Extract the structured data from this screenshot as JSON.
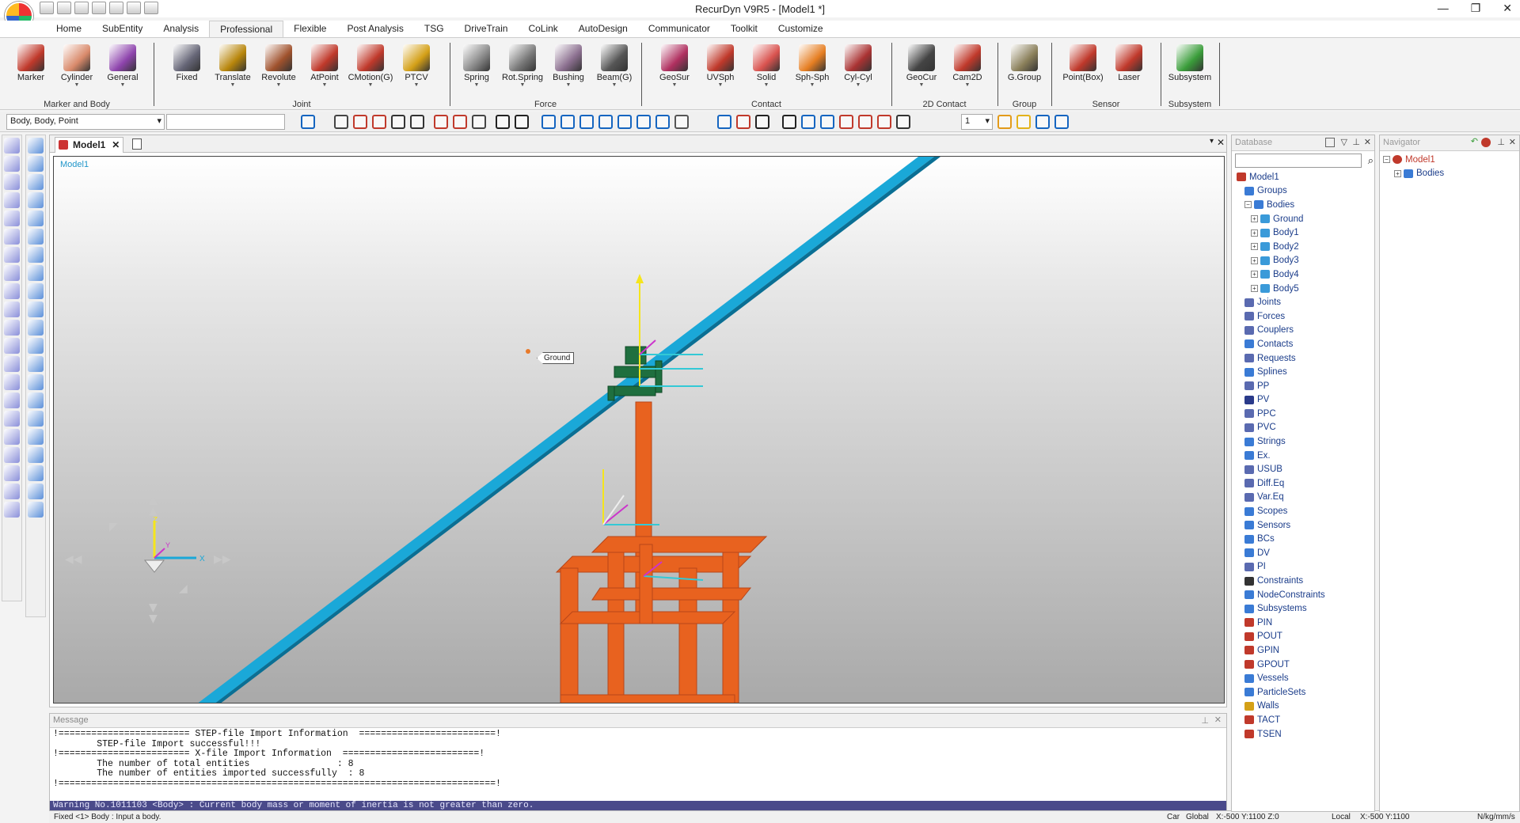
{
  "app": {
    "title": "RecurDyn V9R5  - [Model1 *]",
    "win_min": "—",
    "win_max": "❐",
    "win_close": "✕"
  },
  "ribbon_tabs": [
    "Home",
    "SubEntity",
    "Analysis",
    "Professional",
    "Flexible",
    "Post Analysis",
    "TSG",
    "DriveTrain",
    "CoLink",
    "AutoDesign",
    "Communicator",
    "Toolkit",
    "Customize"
  ],
  "active_tab": "Professional",
  "ribbon_groups": [
    {
      "name": "Marker and Body",
      "items": [
        {
          "label": "Marker",
          "icon": "marker-icon",
          "color": "#c0392b",
          "dd": false
        },
        {
          "label": "Cylinder",
          "icon": "cylinder-icon",
          "color": "#d98a6b",
          "dd": true
        },
        {
          "label": "General",
          "icon": "general-body-icon",
          "color": "#8e44ad",
          "dd": true
        }
      ]
    },
    {
      "name": "Joint",
      "items": [
        {
          "label": "Fixed",
          "icon": "fixed-joint-icon",
          "color": "#667",
          "dd": false
        },
        {
          "label": "Translate",
          "icon": "translate-joint-icon",
          "color": "#b8860b",
          "dd": true
        },
        {
          "label": "Revolute",
          "icon": "revolute-joint-icon",
          "color": "#a0522d",
          "dd": true
        },
        {
          "label": "AtPoint",
          "icon": "atpoint-icon",
          "color": "#c0392b",
          "dd": true
        },
        {
          "label": "CMotion(G)",
          "icon": "cmotion-icon",
          "color": "#c0392b",
          "dd": true
        },
        {
          "label": "PTCV",
          "icon": "ptcv-icon",
          "color": "#d4a017",
          "dd": true
        }
      ]
    },
    {
      "name": "Force",
      "items": [
        {
          "label": "Spring",
          "icon": "spring-icon",
          "color": "#888",
          "dd": true
        },
        {
          "label": "Rot.Spring",
          "icon": "rot-spring-icon",
          "color": "#777",
          "dd": true
        },
        {
          "label": "Bushing",
          "icon": "bushing-icon",
          "color": "#8b6f8f",
          "dd": true
        },
        {
          "label": "Beam(G)",
          "icon": "beam-icon",
          "color": "#555",
          "dd": true
        }
      ]
    },
    {
      "name": "Contact",
      "items": [
        {
          "label": "GeoSur",
          "icon": "geosur-icon",
          "color": "#b03060",
          "dd": true
        },
        {
          "label": "UVSph",
          "icon": "uvsph-icon",
          "color": "#c0392b",
          "dd": true
        },
        {
          "label": "Solid",
          "icon": "solid-contact-icon",
          "color": "#d9534f",
          "dd": true
        },
        {
          "label": "Sph-Sph",
          "icon": "sph-sph-icon",
          "color": "#e67e22",
          "dd": true
        },
        {
          "label": "Cyl-Cyl",
          "icon": "cyl-cyl-icon",
          "color": "#a33",
          "dd": true
        }
      ]
    },
    {
      "name": "2D Contact",
      "items": [
        {
          "label": "GeoCur",
          "icon": "geocur-icon",
          "color": "#444",
          "dd": true
        },
        {
          "label": "Cam2D",
          "icon": "cam2d-icon",
          "color": "#c0392b",
          "dd": true
        }
      ]
    },
    {
      "name": "Group",
      "items": [
        {
          "label": "G.Group",
          "icon": "group-icon",
          "color": "#8a7f5a",
          "dd": false
        }
      ]
    },
    {
      "name": "Sensor",
      "items": [
        {
          "label": "Point(Box)",
          "icon": "point-box-sensor-icon",
          "color": "#c0392b",
          "dd": false
        },
        {
          "label": "Laser",
          "icon": "laser-sensor-icon",
          "color": "#c0392b",
          "dd": false
        }
      ]
    },
    {
      "name": "Subsystem",
      "items": [
        {
          "label": "Subsystem",
          "icon": "subsystem-icon",
          "color": "#3a9d3a",
          "dd": false
        }
      ]
    }
  ],
  "toolbar": {
    "select_value": "Body, Body, Point",
    "layer_value": "1"
  },
  "document": {
    "tab_label": "Model1",
    "viewport_label": "Model1",
    "ground_tag": "Ground",
    "axis_x": "X",
    "axis_y": "Y",
    "axis_z": "Z"
  },
  "message": {
    "title": "Message",
    "lines": [
      "!======================== STEP-file Import Information  =========================!",
      "        STEP-file Import successful!!!",
      "!======================== X-file Import Information  =========================!",
      "        The number of total entities                : 8",
      "        The number of entities imported successfully  : 8",
      "!================================================================================!"
    ],
    "warning": "Warning No.1011103 <Body> : Current body mass or moment of inertia is not greater than zero."
  },
  "status": {
    "left": "Fixed <1> Body : Input a body.",
    "car": "Car",
    "global": "Global",
    "global_coords": "X:-500 Y:1100 Z:0",
    "local": "Local",
    "local_coords": "X:-500 Y:1100",
    "units": "N/kg/mm/s"
  },
  "database": {
    "title": "Database",
    "tree": [
      {
        "label": "Model1",
        "level": 0,
        "pm": "",
        "icon": "model-icon",
        "color": "#c0392b"
      },
      {
        "label": "Groups",
        "level": 1,
        "pm": "",
        "icon": "groups-icon",
        "color": "#3a7bd5"
      },
      {
        "label": "Bodies",
        "level": 1,
        "pm": "−",
        "icon": "bodies-icon",
        "color": "#3a7bd5"
      },
      {
        "label": "Ground",
        "level": 2,
        "pm": "+",
        "icon": "body-icon",
        "color": "#3a9ad9"
      },
      {
        "label": "Body1",
        "level": 2,
        "pm": "+",
        "icon": "body-icon",
        "color": "#3a9ad9"
      },
      {
        "label": "Body2",
        "level": 2,
        "pm": "+",
        "icon": "body-icon",
        "color": "#3a9ad9"
      },
      {
        "label": "Body3",
        "level": 2,
        "pm": "+",
        "icon": "body-icon",
        "color": "#3a9ad9"
      },
      {
        "label": "Body4",
        "level": 2,
        "pm": "+",
        "icon": "body-icon",
        "color": "#3a9ad9"
      },
      {
        "label": "Body5",
        "level": 2,
        "pm": "+",
        "icon": "body-icon",
        "color": "#3a9ad9"
      },
      {
        "label": "Joints",
        "level": 1,
        "pm": "",
        "icon": "joints-icon",
        "color": "#5a6ab0"
      },
      {
        "label": "Forces",
        "level": 1,
        "pm": "",
        "icon": "forces-icon",
        "color": "#5a6ab0"
      },
      {
        "label": "Couplers",
        "level": 1,
        "pm": "",
        "icon": "couplers-icon",
        "color": "#5a6ab0"
      },
      {
        "label": "Contacts",
        "level": 1,
        "pm": "",
        "icon": "contacts-icon",
        "color": "#3a7bd5"
      },
      {
        "label": "Requests",
        "level": 1,
        "pm": "",
        "icon": "requests-icon",
        "color": "#5a6ab0"
      },
      {
        "label": "Splines",
        "level": 1,
        "pm": "",
        "icon": "splines-icon",
        "color": "#3a7bd5"
      },
      {
        "label": "PP",
        "level": 1,
        "pm": "",
        "icon": "pp-icon",
        "color": "#5a6ab0"
      },
      {
        "label": "PV",
        "level": 1,
        "pm": "",
        "icon": "pv-icon",
        "color": "#2a3a8a"
      },
      {
        "label": "PPC",
        "level": 1,
        "pm": "",
        "icon": "ppc-icon",
        "color": "#5a6ab0"
      },
      {
        "label": "PVC",
        "level": 1,
        "pm": "",
        "icon": "pvc-icon",
        "color": "#5a6ab0"
      },
      {
        "label": "Strings",
        "level": 1,
        "pm": "",
        "icon": "strings-icon",
        "color": "#3a7bd5"
      },
      {
        "label": "Ex.",
        "level": 1,
        "pm": "",
        "icon": "expression-icon",
        "color": "#3a7bd5"
      },
      {
        "label": "USUB",
        "level": 1,
        "pm": "",
        "icon": "usub-icon",
        "color": "#5a6ab0"
      },
      {
        "label": "Diff.Eq",
        "level": 1,
        "pm": "",
        "icon": "diffeq-icon",
        "color": "#5a6ab0"
      },
      {
        "label": "Var.Eq",
        "level": 1,
        "pm": "",
        "icon": "vareq-icon",
        "color": "#5a6ab0"
      },
      {
        "label": "Scopes",
        "level": 1,
        "pm": "",
        "icon": "scopes-icon",
        "color": "#3a7bd5"
      },
      {
        "label": "Sensors",
        "level": 1,
        "pm": "",
        "icon": "sensors-icon",
        "color": "#3a7bd5"
      },
      {
        "label": "BCs",
        "level": 1,
        "pm": "",
        "icon": "bcs-icon",
        "color": "#3a7bd5"
      },
      {
        "label": "DV",
        "level": 1,
        "pm": "",
        "icon": "dv-icon",
        "color": "#3a7bd5"
      },
      {
        "label": "PI",
        "level": 1,
        "pm": "",
        "icon": "pi-icon",
        "color": "#5a6ab0"
      },
      {
        "label": "Constraints",
        "level": 1,
        "pm": "",
        "icon": "constraints-icon",
        "color": "#333"
      },
      {
        "label": "NodeConstraints",
        "level": 1,
        "pm": "",
        "icon": "node-constraints-icon",
        "color": "#3a7bd5"
      },
      {
        "label": "Subsystems",
        "level": 1,
        "pm": "",
        "icon": "subsystems-icon",
        "color": "#3a7bd5"
      },
      {
        "label": "PIN",
        "level": 1,
        "pm": "",
        "icon": "pin-icon",
        "color": "#c0392b"
      },
      {
        "label": "POUT",
        "level": 1,
        "pm": "",
        "icon": "pout-icon",
        "color": "#c0392b"
      },
      {
        "label": "GPIN",
        "level": 1,
        "pm": "",
        "icon": "gpin-icon",
        "color": "#c0392b"
      },
      {
        "label": "GPOUT",
        "level": 1,
        "pm": "",
        "icon": "gpout-icon",
        "color": "#c0392b"
      },
      {
        "label": "Vessels",
        "level": 1,
        "pm": "",
        "icon": "vessels-icon",
        "color": "#3a7bd5"
      },
      {
        "label": "ParticleSets",
        "level": 1,
        "pm": "",
        "icon": "particle-sets-icon",
        "color": "#3a7bd5"
      },
      {
        "label": "Walls",
        "level": 1,
        "pm": "",
        "icon": "walls-icon",
        "color": "#d4a017"
      },
      {
        "label": "TACT",
        "level": 1,
        "pm": "",
        "icon": "tact-icon",
        "color": "#c0392b"
      },
      {
        "label": "TSEN",
        "level": 1,
        "pm": "",
        "icon": "tsen-icon",
        "color": "#c0392b"
      }
    ]
  },
  "navigator": {
    "title": "Navigator",
    "tree": [
      {
        "label": "Model1",
        "pm": "−",
        "color": "#c0392b"
      },
      {
        "label": "Bodies",
        "pm": "+",
        "color": "#3a7bd5"
      }
    ]
  }
}
